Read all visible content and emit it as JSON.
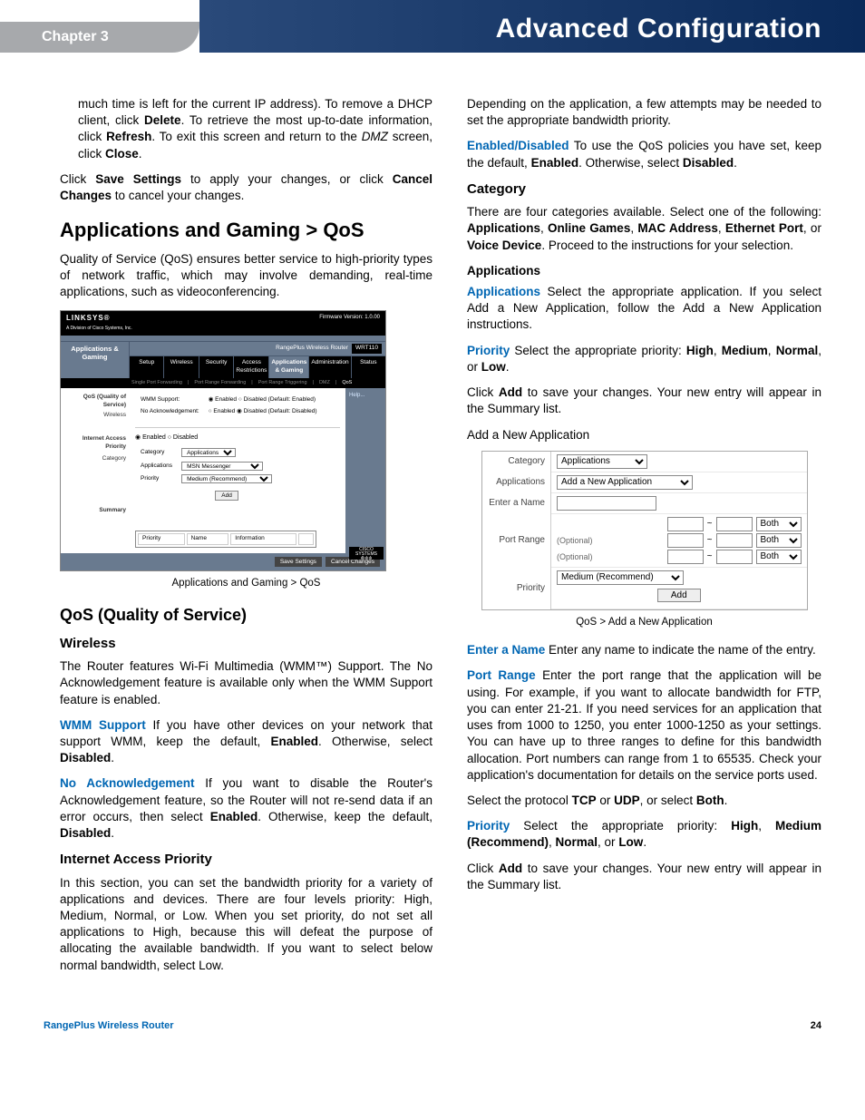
{
  "header": {
    "chapter": "Chapter 3",
    "title": "Advanced Configuration"
  },
  "left": {
    "intro": "much time is left for the current IP address). To remove a DHCP client, click ",
    "intro_delete": "Delete",
    "intro2": ". To retrieve the most up-to-date information, click ",
    "intro_refresh": "Refresh",
    "intro3": ". To exit this screen and return to the ",
    "intro_dmz": "DMZ",
    "intro4": " screen, click ",
    "intro_close": "Close",
    "intro5": ".",
    "save_p1": "Click ",
    "save_b1": "Save Settings",
    "save_p2": " to apply your changes, or click ",
    "save_b2": "Cancel Changes",
    "save_p3": " to cancel your changes.",
    "h2": "Applications and Gaming > QoS",
    "qos_desc": "Quality of Service (QoS) ensures better service to high-priority types of network traffic, which may involve demanding, real-time applications, such as videoconferencing.",
    "caption1": "Applications and Gaming > QoS",
    "h3": "QoS (Quality of Service)",
    "h4_wireless": "Wireless",
    "wireless_p": "The Router features Wi-Fi Multimedia (WMM™) Support. The No Acknowledgement feature is available only when the WMM Support feature is enabled.",
    "wmm_term": "WMM Support",
    "wmm_p1": "  If you have other devices on your network that support WMM, keep the default, ",
    "wmm_b1": "Enabled",
    "wmm_p2": ". Otherwise, select ",
    "wmm_b2": "Disabled",
    "wmm_p3": ".",
    "noack_term": "No Acknowledgement",
    "noack_p1": "  If you want to disable the Router's Acknowledgement feature, so the Router will not re-send data if an error occurs, then select ",
    "noack_b1": "Enabled",
    "noack_p2": ". Otherwise, keep the default, ",
    "noack_b2": "Disabled",
    "noack_p3": ".",
    "h4_iap": "Internet Access Priority",
    "iap_p": "In this section, you can set the bandwidth priority for a variety of applications and devices. There are four levels priority: High, Medium, Normal, or Low. When you set priority, do not set all applications to High, because this will defeat the purpose of allocating the available bandwidth. If you want to select below normal bandwidth, select Low."
  },
  "right": {
    "depend_p": "Depending on the application, a few attempts may be needed to set the appropriate bandwidth priority.",
    "ed_term": "Enabled/Disabled",
    "ed_p1": "  To use the QoS policies you have set, keep the default, ",
    "ed_b1": "Enabled",
    "ed_p2": ". Otherwise, select ",
    "ed_b2": "Disabled",
    "ed_p3": ".",
    "h4_cat": "Category",
    "cat_p1": "There are four categories available. Select one of the following: ",
    "cat_b1": "Applications",
    "cat_c1": ", ",
    "cat_b2": "Online Games",
    "cat_c2": ", ",
    "cat_b3": "MAC Address",
    "cat_c3": ", ",
    "cat_b4": "Ethernet Port",
    "cat_c4": ", or ",
    "cat_b5": "Voice Device",
    "cat_p2": ". Proceed to the instructions for your selection.",
    "h5_apps": "Applications",
    "apps_term": "Applications",
    "apps_p": "  Select the appropriate application. If you select Add a New Application, follow the Add a New Application instructions.",
    "prio_term": "Priority",
    "prio_p1": "  Select the appropriate priority: ",
    "prio_b1": "High",
    "prio_c1": ", ",
    "prio_b2": "Medium",
    "prio_c2": ", ",
    "prio_b3": "Normal",
    "prio_c3": ", or ",
    "prio_b4": "Low",
    "prio_p2": ".",
    "add_p1": "Click ",
    "add_b": "Add",
    "add_p2": " to save your changes. Your new entry will appear in the Summary list.",
    "addnew": "Add a New Application",
    "caption2": "QoS > Add a New Application",
    "name_term": "Enter a Name",
    "name_p": "  Enter any name to indicate the name of the entry.",
    "port_term": "Port Range",
    "port_p": "  Enter the port range that the application will be using. For example, if you want to allocate bandwidth for FTP, you can enter 21-21. If you need services for an application that uses from 1000 to 1250, you enter 1000-1250 as your settings. You can have up to three ranges to define for this bandwidth allocation. Port numbers can range from 1 to 65535. Check your application's documentation for details on the service ports used.",
    "proto_p1": "Select the protocol ",
    "proto_b1": "TCP",
    "proto_p2": " or ",
    "proto_b2": "UDP",
    "proto_p3": ", or select ",
    "proto_b3": "Both",
    "proto_p4": ".",
    "prio2_term": "Priority",
    "prio2_p1": "  Select the appropriate priority: ",
    "prio2_b1": "High",
    "prio2_c1": ", ",
    "prio2_b2": "Medium (Recommend)",
    "prio2_c2": ", ",
    "prio2_b3": "Normal",
    "prio2_c3": ", or ",
    "prio2_b4": "Low",
    "prio2_p2": ".",
    "add2_p1": "Click ",
    "add2_b": "Add",
    "add2_p2": " to save your changes. Your new entry will appear in the Summary list."
  },
  "shot1": {
    "brand": "LINKSYS®",
    "brand_sub": "A Division of Cisco Systems, Inc.",
    "fw": "Firmware Version: 1.0.00",
    "model_label": "RangePlus Wireless Router",
    "model": "WRT110",
    "section": "Applications & Gaming",
    "tabs": [
      "Setup",
      "Wireless",
      "Security",
      "Access Restrictions",
      "Applications & Gaming",
      "Administration",
      "Status"
    ],
    "subtabs": [
      "Single Port Forwarding",
      "Port Range Forwarding",
      "Port Range Triggering",
      "DMZ",
      "QoS"
    ],
    "labels": {
      "qos": "QoS (Quality of Service)",
      "wireless": "Wireless",
      "iap": "Internet Access Priority",
      "category": "Category",
      "summary": "Summary"
    },
    "wmm": "WMM Support:",
    "noack": "No Acknowledgement:",
    "radio_en": "Enabled",
    "radio_dis": "Disabled (Default: Enabled)",
    "radio_dis2": "Disabled (Default: Disabled)",
    "iap_en": "Enabled",
    "iap_dis": "Disabled",
    "cat_label": "Category",
    "cat_val": "Applications",
    "apps_label": "Applications",
    "apps_val": "MSN Messenger",
    "prio_label": "Priority",
    "prio_val": "Medium (Recommend)",
    "add": "Add",
    "sum_cols": [
      "Priority",
      "Name",
      "Information"
    ],
    "save": "Save Settings",
    "cancel": "Cancel Changes",
    "help": "Help..."
  },
  "shot2": {
    "category_label": "Category",
    "category_val": "Applications",
    "apps_label": "Applications",
    "apps_val": "Add a New Application",
    "name_label": "Enter a Name",
    "port_label": "Port Range",
    "optional": "(Optional)",
    "to": "~",
    "both": "Both",
    "priority_label": "Priority",
    "priority_val": "Medium (Recommend)",
    "add": "Add"
  },
  "footer": {
    "product": "RangePlus Wireless Router",
    "page": "24"
  }
}
